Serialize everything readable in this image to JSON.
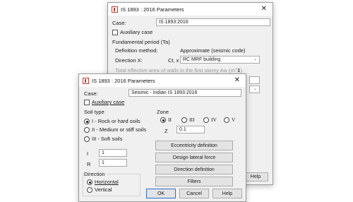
{
  "back_dialog": {
    "title": "IS 1893 : 2016 Parameters",
    "case_label": "Case:",
    "case_value": "IS 1893:2016",
    "auxiliary_label": "Auxiliary case",
    "fundamental_period_label": "Fundamental period (Ta)",
    "definition_method_label": "Definition method:",
    "definition_method_value": "Approximate (seismic code)",
    "direction_x_label": "Direction X:",
    "ct_label": "Ct, x",
    "ct_value": "RC MRF building",
    "total_area_label": "Total effective area of walls in the first storey Aw (m^2)",
    "total_area_value": "1",
    "help_label": "Help"
  },
  "front_dialog": {
    "title": "IS 1893 : 2016 Parameters",
    "case_label": "Case:",
    "case_value": "Seismic - Indian IS 1893:2016",
    "auxiliary_label": "Auxiliary case",
    "soil_type_label": "Soil type",
    "soil_options": [
      "I - Rock or hard soils",
      "II - Medium or stiff soils",
      "III - Soft soils"
    ],
    "i_label": "I",
    "i_value": "1",
    "r_label": "R",
    "r_value": "1",
    "direction_label": "Direction",
    "direction_options": [
      "Horizontal",
      "Vertical"
    ],
    "zone_label": "Zone",
    "zone_options": [
      "II",
      "III",
      "IV",
      "V"
    ],
    "z_label": "Z",
    "z_value": "0.1",
    "buttons": {
      "eccentricity": "Eccentricity definition",
      "design_lateral_force": "Design lateral force",
      "direction_definition": "Direction definition",
      "filters": "Filters",
      "ok": "OK",
      "cancel": "Cancel",
      "help": "Help"
    }
  }
}
